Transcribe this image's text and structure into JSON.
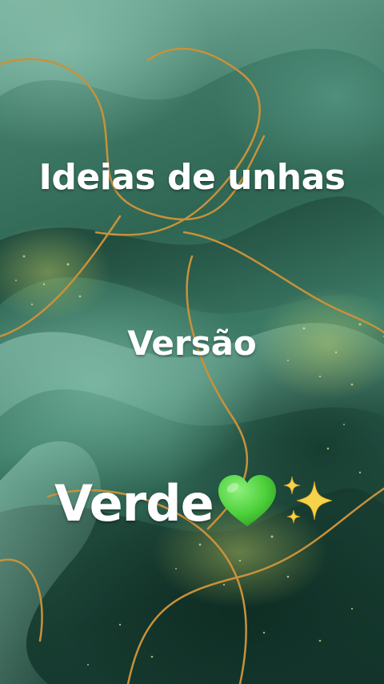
{
  "image": {
    "background_color": "#2e6553",
    "accent_gold": "#c8913a",
    "texts": {
      "title": "Ideias de unhas",
      "subtitle": "Versão",
      "word": "Verde"
    },
    "decorations": {
      "heart": "green-heart-icon",
      "heart_color": "#4ccf3a",
      "sparkles": "sparkles-icon",
      "sparkles_color": "#f6d34a"
    }
  }
}
